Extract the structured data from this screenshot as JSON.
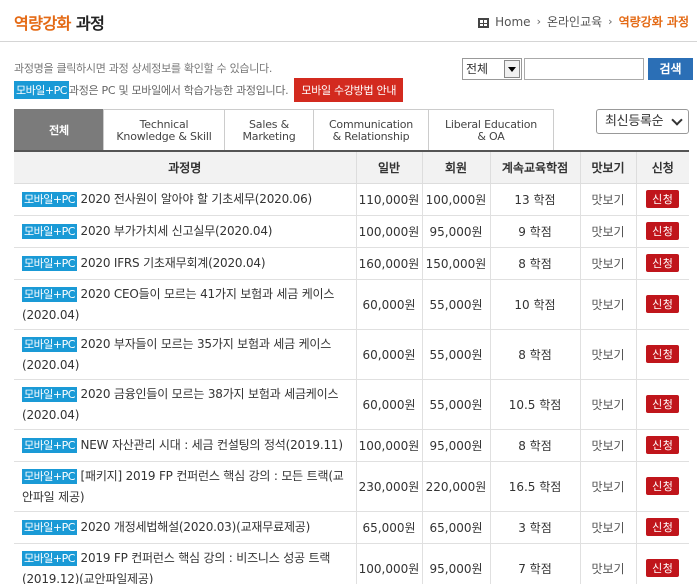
{
  "header": {
    "title_prefix": "역량강화",
    "title_suffix": " 과정",
    "breadcrumb": [
      "Home",
      "온라인교육",
      "역량강화 과정"
    ]
  },
  "info": {
    "line1": "과정명을 클릭하시면 과정 상세정보를 확인할 수 있습니다.",
    "tag": "모바일+PC",
    "line2": "과정은 PC 및 모바일에서 학습가능한 과정입니다.",
    "mobile_guide": "모바일 수강방법 안내"
  },
  "search": {
    "filter_value": "전체",
    "input_value": "",
    "button_label": "검색"
  },
  "tabs": [
    {
      "label": "전체",
      "active": true
    },
    {
      "label": "Technical Knowledge & Skill",
      "line1": "Technical",
      "line2": "Knowledge & Skill"
    },
    {
      "label": "Sales & Marketing",
      "line1": "Sales &",
      "line2": "Marketing"
    },
    {
      "label": "Communication & Relationship",
      "line1": "Communication",
      "line2": "& Relationship"
    },
    {
      "label": "Liberal Education & OA",
      "line1": "Liberal Education",
      "line2": "& OA"
    }
  ],
  "sort": {
    "value": "최신등록순"
  },
  "table": {
    "headers": [
      "과정명",
      "일반",
      "회원",
      "계속교육학점",
      "맛보기",
      "신청"
    ],
    "rows": [
      {
        "tag": "모바일+PC",
        "title": "2020 전사원이 알아야 할 기초세무(2020.06)",
        "general": "110,000원",
        "member": "100,000원",
        "credit": "13 학점",
        "preview": "맛보기",
        "apply": "신청"
      },
      {
        "tag": "모바일+PC",
        "title": "2020 부가가치세 신고실무(2020.04)",
        "general": "100,000원",
        "member": "95,000원",
        "credit": "9 학점",
        "preview": "맛보기",
        "apply": "신청"
      },
      {
        "tag": "모바일+PC",
        "title": "2020 IFRS 기초재무회계(2020.04)",
        "general": "160,000원",
        "member": "150,000원",
        "credit": "8 학점",
        "preview": "맛보기",
        "apply": "신청"
      },
      {
        "tag": "모바일+PC",
        "title": "2020 CEO들이 모르는 41가지 보험과 세금 케이스 (2020.04)",
        "general": "60,000원",
        "member": "55,000원",
        "credit": "10 학점",
        "preview": "맛보기",
        "apply": "신청"
      },
      {
        "tag": "모바일+PC",
        "title": "2020 부자들이 모르는 35가지 보험과 세금 케이스 (2020.04)",
        "general": "60,000원",
        "member": "55,000원",
        "credit": "8 학점",
        "preview": "맛보기",
        "apply": "신청"
      },
      {
        "tag": "모바일+PC",
        "title": "2020 금융인들이 모르는 38가지 보험과 세금케이스 (2020.04)",
        "general": "60,000원",
        "member": "55,000원",
        "credit": "10.5 학점",
        "preview": "맛보기",
        "apply": "신청"
      },
      {
        "tag": "모바일+PC",
        "title": "NEW 자산관리 시대 : 세금 컨설팅의 정석(2019.11)",
        "general": "100,000원",
        "member": "95,000원",
        "credit": "8 학점",
        "preview": "맛보기",
        "apply": "신청"
      },
      {
        "tag": "모바일+PC",
        "title": "[패키지] 2019 FP 컨퍼런스 핵심 강의 : 모든 트랙(교안파일 제공)",
        "general": "230,000원",
        "member": "220,000원",
        "credit": "16.5 학점",
        "preview": "맛보기",
        "apply": "신청"
      },
      {
        "tag": "모바일+PC",
        "title": "2020 개정세법해설(2020.03)(교재무료제공)",
        "general": "65,000원",
        "member": "65,000원",
        "credit": "3 학점",
        "preview": "맛보기",
        "apply": "신청"
      },
      {
        "tag": "모바일+PC",
        "title": "2019 FP 컨퍼런스 핵심 강의 : 비즈니스 성공 트랙 (2019.12)(교안파일제공)",
        "general": "100,000원",
        "member": "95,000원",
        "credit": "7 학점",
        "preview": "맛보기",
        "apply": "신청"
      }
    ]
  },
  "colors": {
    "accent": "#e46a15",
    "tag_blue": "#1a9ad6",
    "apply_red": "#c0151b",
    "search_blue": "#2b6fb6"
  },
  "icons": {
    "home": "home-icon",
    "breadcrumb_separator": "chevron-right-icon",
    "select_arrow": "chevron-down-icon"
  }
}
